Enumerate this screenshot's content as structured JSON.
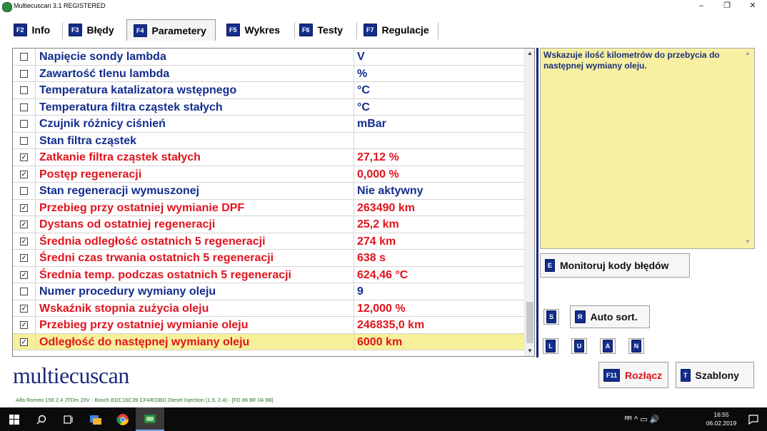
{
  "window": {
    "title": "Multiecuscan 3.1 REGISTERED",
    "minimize_glyph": "–",
    "maximize_glyph": "❐",
    "close_glyph": "✕"
  },
  "tabs": [
    {
      "key": "F2",
      "label": "Info",
      "active": false
    },
    {
      "key": "F3",
      "label": "Błędy",
      "active": false
    },
    {
      "key": "F4",
      "label": "Parametery",
      "active": true
    },
    {
      "key": "F5",
      "label": "Wykres",
      "active": false
    },
    {
      "key": "F6",
      "label": "Testy",
      "active": false
    },
    {
      "key": "F7",
      "label": "Regulacje",
      "active": false
    }
  ],
  "parameters": [
    {
      "checked": false,
      "name": "Napięcie sondy lambda",
      "value": "V"
    },
    {
      "checked": false,
      "name": "Zawartość tlenu lambda",
      "value": "%"
    },
    {
      "checked": false,
      "name": "Temperatura katalizatora wstępnego",
      "value": "°C"
    },
    {
      "checked": false,
      "name": "Temperatura filtra cząstek stałych",
      "value": "°C"
    },
    {
      "checked": false,
      "name": "Czujnik różnicy ciśnień",
      "value": "mBar"
    },
    {
      "checked": false,
      "name": "Stan filtra cząstek",
      "value": ""
    },
    {
      "checked": true,
      "name": "Zatkanie filtra cząstek stałych",
      "value": "27,12 %"
    },
    {
      "checked": true,
      "name": "Postęp regeneracji",
      "value": "0,000 %"
    },
    {
      "checked": false,
      "name": "Stan regeneracji wymuszonej",
      "value": "Nie aktywny"
    },
    {
      "checked": true,
      "name": "Przebieg przy ostatniej wymianie DPF",
      "value": "263490 km"
    },
    {
      "checked": true,
      "name": "Dystans od ostatniej regeneracji",
      "value": "25,2 km"
    },
    {
      "checked": true,
      "name": "Średnia odległość ostatnich 5 regeneracji",
      "value": "274 km"
    },
    {
      "checked": true,
      "name": "Średni czas trwania ostatnich 5 regeneracji",
      "value": "638 s"
    },
    {
      "checked": true,
      "name": "Średnia temp. podczas ostatnich 5 regeneracji",
      "value": "624,46 °C"
    },
    {
      "checked": false,
      "name": "Numer procedury wymiany oleju",
      "value": "9"
    },
    {
      "checked": true,
      "name": "Wskaźnik stopnia zużycia oleju",
      "value": "12,000 %"
    },
    {
      "checked": true,
      "name": "Przebieg przy ostatniej wymianie oleju",
      "value": "246835,0 km"
    },
    {
      "checked": true,
      "name": "Odległość do następnej wymiany oleju",
      "value": "6000 km",
      "selected": true
    }
  ],
  "description": "Wskazuje ilość kilometrów do przebycia do następnej wymiany oleju.",
  "buttons": {
    "monitor": {
      "key": "E",
      "label": "Monitoruj kody błędów"
    },
    "sort_key": "S",
    "auto_sort": {
      "key": "R",
      "label": "Auto sort."
    },
    "letter_keys": [
      "L",
      "U",
      "A",
      "N"
    ],
    "disconnect": {
      "key": "F11",
      "label": "Rozłącz"
    },
    "templates": {
      "key": "T",
      "label": "Szablony"
    }
  },
  "logo": "multiecuscan",
  "vehicle_info": "Alfa Romeo 159 2.4 JTDm 20V - Bosch EDC16C39 CF4/EOBD Diesel Injection (1.9, 2.4) - [FD 86 BF 04 9B]",
  "taskbar": {
    "tray": "ᴿᴿ  ^  ▭  🔊",
    "time": "16:55",
    "date": "06.02.2019"
  },
  "colors": {
    "checked_text": "#e0141e",
    "unchecked_text": "#132d8c",
    "selected_row": "#f7f09a",
    "key_badge": "#132d8c",
    "description_bg": "#f7f0a2"
  }
}
